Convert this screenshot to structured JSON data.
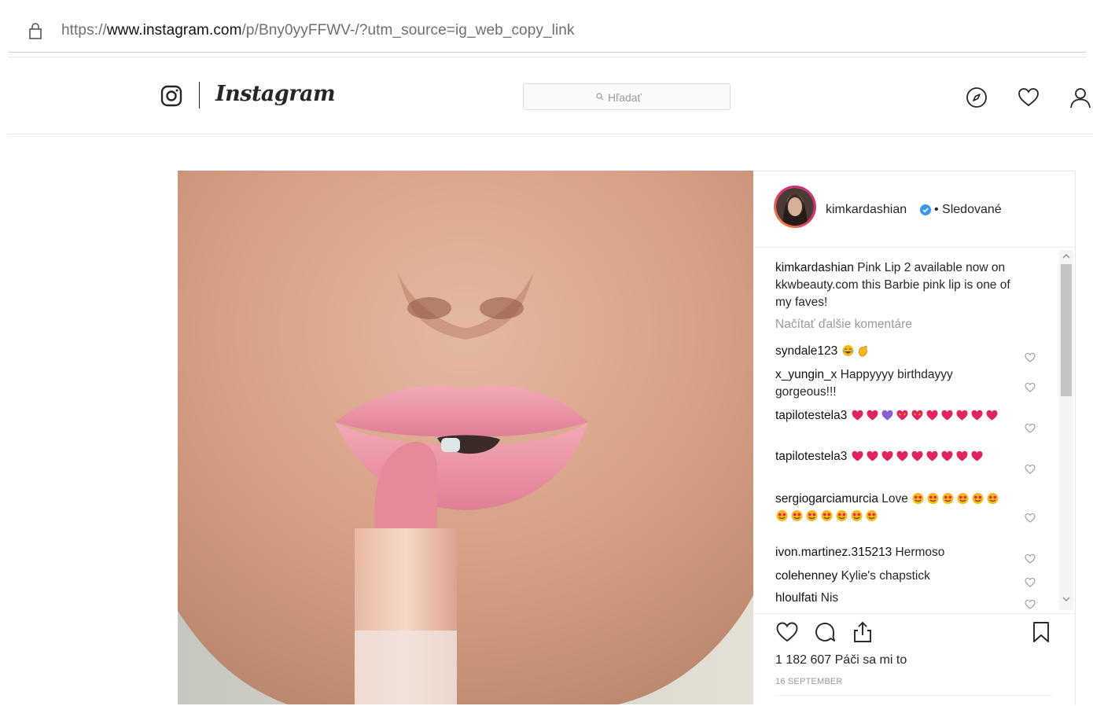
{
  "browser": {
    "url_prefix": "https://",
    "url_domain": "www.instagram.com",
    "url_path": "/p/Bny0yyFFWV-/?utm_source=ig_web_copy_link",
    "lock_icon": "lock-icon"
  },
  "nav": {
    "logo_icon": "instagram-camera-icon",
    "wordmark": "Instagram",
    "search_placeholder": "Hľadať",
    "icons": [
      "compass-icon",
      "heart-icon",
      "profile-icon"
    ]
  },
  "post": {
    "username": "kimkardashian",
    "follow_status": "• Sledované",
    "caption_user": "kimkardashian",
    "caption_text": "Pink Lip 2 available now on kkwbeauty.com this Barbie pink lip is one of my faves!",
    "load_more": "Načítať ďalšie komentáre",
    "comments": [
      {
        "user": "syndale123",
        "text": "",
        "emoji": [
          "joy",
          "clap"
        ]
      },
      {
        "user": "x_yungin_x",
        "text": "Happyyyy birthdayyy gorgeous!!!",
        "emoji": []
      },
      {
        "user": "tapilotestela3",
        "text": "",
        "emoji": [
          "red-heart",
          "red-heart",
          "purple-heart",
          "heart-eyes",
          "heart-eyes",
          "red-heart",
          "red-heart",
          "red-heart",
          "red-heart",
          "red-heart"
        ]
      },
      {
        "user": "tapilotestela3",
        "text": "",
        "emoji": [
          "red-heart",
          "red-heart",
          "red-heart",
          "red-heart",
          "red-heart",
          "red-heart",
          "red-heart",
          "red-heart",
          "red-heart"
        ]
      },
      {
        "user": "sergiogarciamurcia",
        "text": "Love",
        "emoji": [
          "star-struck",
          "star-struck",
          "star-struck",
          "star-struck",
          "star-struck",
          "star-struck",
          "star-struck",
          "star-struck",
          "star-struck",
          "star-struck",
          "star-struck",
          "star-struck",
          "star-struck"
        ]
      },
      {
        "user": "ivon.martinez.315213",
        "text": "Hermoso",
        "emoji": []
      },
      {
        "user": "colehenney",
        "text": "Kylie's chapstick",
        "emoji": []
      },
      {
        "user": "hloulfati",
        "text": "Nis",
        "emoji": []
      }
    ],
    "likes": "1 182 607 Páči sa mi to",
    "date": "16 SEPTEMBER"
  },
  "colors": {
    "text": "#262626",
    "muted": "#999999",
    "verified": "#3897f0",
    "emoji_red": "#e0245e",
    "emoji_purple": "#8a5fd6",
    "emoji_yellow": "#f5b919"
  }
}
